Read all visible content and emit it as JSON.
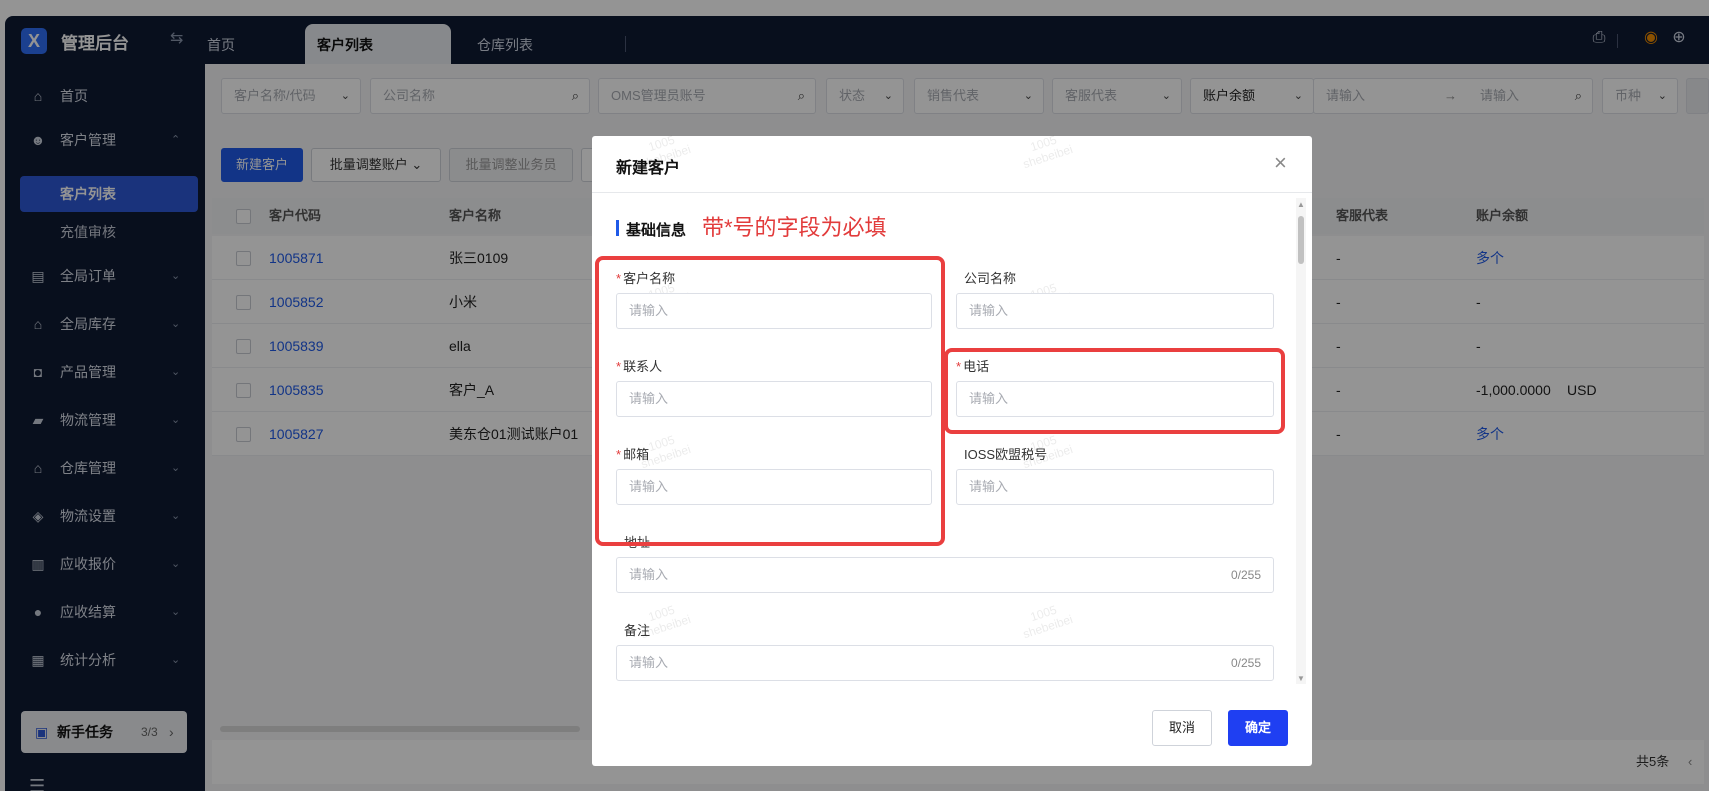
{
  "app": {
    "title": "管理后台",
    "logo_letter": "X"
  },
  "tabs": [
    {
      "label": "首页"
    },
    {
      "label": "客户列表"
    },
    {
      "label": "仓库列表"
    }
  ],
  "sidebar": {
    "items": [
      {
        "label": "首页",
        "icon": "home-icon"
      },
      {
        "label": "客户管理",
        "icon": "users-icon",
        "expanded": true
      },
      {
        "label": "全局订单",
        "icon": "clipboard-icon"
      },
      {
        "label": "全局库存",
        "icon": "warehouse-icon"
      },
      {
        "label": "产品管理",
        "icon": "bag-icon"
      },
      {
        "label": "物流管理",
        "icon": "truck-icon"
      },
      {
        "label": "仓库管理",
        "icon": "home-box-icon"
      },
      {
        "label": "物流设置",
        "icon": "cube-icon"
      },
      {
        "label": "应收报价",
        "icon": "document-icon"
      },
      {
        "label": "应收结算",
        "icon": "coin-icon"
      },
      {
        "label": "统计分析",
        "icon": "chart-icon"
      }
    ],
    "sub_items": [
      {
        "label": "客户列表",
        "active": true
      },
      {
        "label": "充值审核",
        "active": false
      }
    ],
    "newbie": {
      "label": "新手任务",
      "progress": "3/3"
    }
  },
  "filters": {
    "customer_code": "客户名称/代码",
    "company": "公司名称",
    "oms_account": "OMS管理员账号",
    "status": "状态",
    "sales_rep": "销售代表",
    "service_rep": "客服代表",
    "balance": "账户余额",
    "min_placeholder": "请输入",
    "max_placeholder": "请输入",
    "currency": "币种"
  },
  "actions": {
    "new_customer": "新建客户",
    "batch_adjust_account": "批量调整账户",
    "batch_adjust_sales": "批量调整业务员"
  },
  "table": {
    "headers": [
      "客户代码",
      "客户名称",
      "客服代表",
      "账户余额"
    ],
    "rows": [
      {
        "code": "1005871",
        "name": "张三0109",
        "service": "-",
        "balance": "多个",
        "balance_link": true
      },
      {
        "code": "1005852",
        "name": "小米",
        "service": "-",
        "balance": "-",
        "balance_link": false
      },
      {
        "code": "1005839",
        "name": "ella",
        "service": "-",
        "balance": "-",
        "balance_link": false
      },
      {
        "code": "1005835",
        "name": "客户_A",
        "service": "-",
        "balance": "-1,000.0000",
        "currency": "USD",
        "balance_link": false
      },
      {
        "code": "1005827",
        "name": "美东仓01测试账户01",
        "service": "-",
        "balance": "多个",
        "balance_link": true
      }
    ],
    "total": "共5条"
  },
  "modal": {
    "title": "新建客户",
    "section": "基础信息",
    "note": "带*号的字段为必填",
    "fields": {
      "customer_name": {
        "label": "客户名称",
        "placeholder": "请输入",
        "required": true
      },
      "company_name": {
        "label": "公司名称",
        "placeholder": "请输入",
        "required": false
      },
      "contact": {
        "label": "联系人",
        "placeholder": "请输入",
        "required": true
      },
      "phone": {
        "label": "电话",
        "placeholder": "请输入",
        "required": true
      },
      "email": {
        "label": "邮箱",
        "placeholder": "请输入",
        "required": true
      },
      "ioss": {
        "label": "IOSS欧盟税号",
        "placeholder": "请输入",
        "required": false
      },
      "address": {
        "label": "地址",
        "placeholder": "请输入",
        "count": "0/255"
      },
      "remark": {
        "label": "备注",
        "placeholder": "请输入",
        "count": "0/255"
      }
    },
    "cancel": "取消",
    "confirm": "确定"
  },
  "watermark": {
    "line1": "1005",
    "line2": "shebeibei"
  },
  "colors": {
    "primary": "#1f5ae8",
    "sidebar": "#0f1a33",
    "required": "#e23b3b",
    "highlight": "#ea3f3f"
  }
}
